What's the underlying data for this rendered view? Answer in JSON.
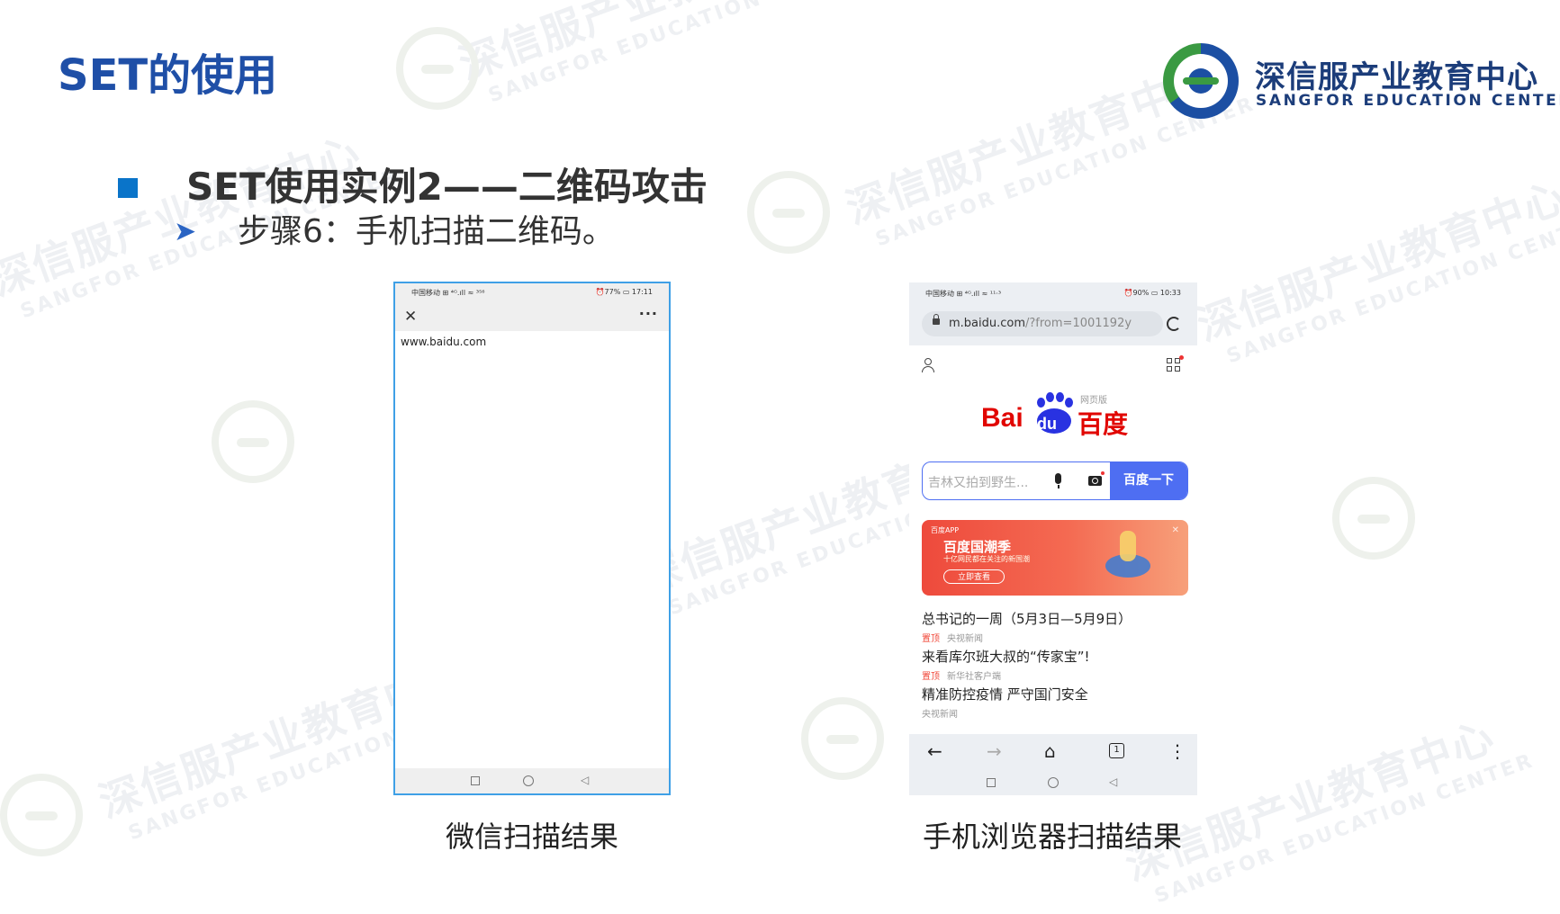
{
  "slide": {
    "title": "SET的使用",
    "heading": "SET使用实例2——二维码攻击",
    "step_text": "步骤6：手机扫描二维码。",
    "brand": {
      "name_cn": "深信服产业教育中心",
      "name_en": "SANGFOR EDUCATION CENTER"
    },
    "watermark": {
      "cn": "深信服产业教育中心",
      "en": "SANGFOR EDUCATION CENTER"
    },
    "colors": {
      "title": "#1f4fa7",
      "bullet": "#0a74c9",
      "arrow": "#2a64c3",
      "phone_border": "#3fa0e6",
      "baidu_red": "#e10601",
      "baidu_blue": "#2932e1",
      "search_button": "#4e6ef2"
    }
  },
  "left_phone": {
    "status_left": "中国移动 ⊞ ⁴ᴳ.ıll ≈ ³⁵⁶",
    "status_right": "⏰77% ▭ 17:11",
    "close_icon": "close-icon",
    "more_icon": "more-icon",
    "url_text": "www.baidu.com",
    "caption": "微信扫描结果"
  },
  "right_phone": {
    "status_left": "中国移动 ⊞ ⁴ᴳ.ıll ≈ ¹¹·³",
    "status_right": "⏰90% ▭ 10:33",
    "url_main": "m.baidu.com",
    "url_rest": "/?from=1001192y",
    "logo_latin": "Bai",
    "logo_du": "du",
    "logo_cn": "百度",
    "logo_web": "网页版",
    "search_placeholder": "吉林又拍到野生...",
    "search_button": "百度一下",
    "banner": {
      "tag": "百度APP",
      "title": "百度国潮季",
      "subtitle": "十亿网民都在关注的新国潮",
      "button": "立即查看"
    },
    "news": [
      {
        "title": "总书记的一周（5月3日—5月9日）",
        "tag": "置顶",
        "source": "央视新闻"
      },
      {
        "title": "来看库尔班大叔的“传家宝”!",
        "tag": "置顶",
        "source": "新华社客户端"
      },
      {
        "title": "精准防控疫情 严守国门安全",
        "tag": "",
        "source": "央视新闻"
      }
    ],
    "tabs_count": "1",
    "caption": "手机浏览器扫描结果"
  }
}
